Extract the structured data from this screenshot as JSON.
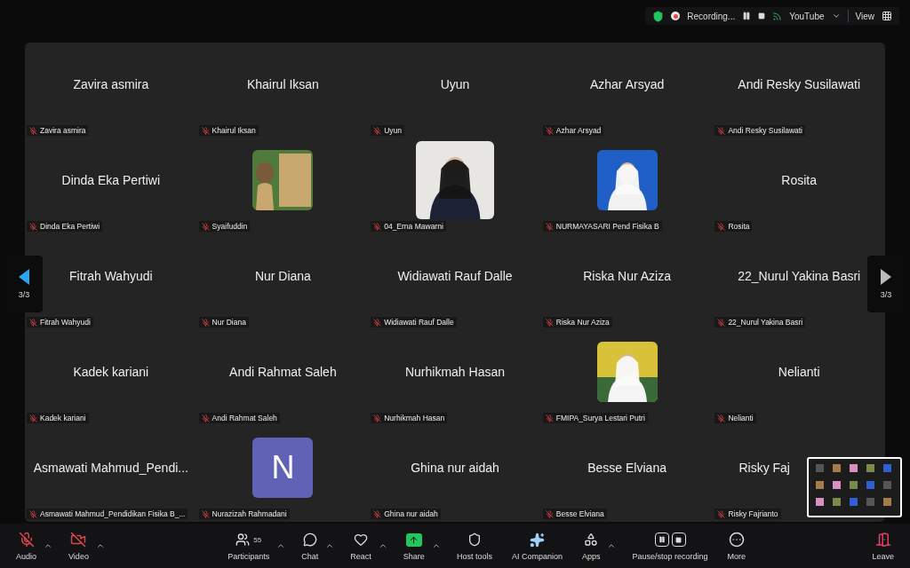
{
  "top_bar": {
    "recording": {
      "label": "Recording..."
    },
    "stream": {
      "label": "YouTube"
    },
    "view": {
      "label": "View"
    }
  },
  "gallery": {
    "page_left": "3/3",
    "page_right": "3/3",
    "tiles": [
      {
        "kind": "name",
        "display": "Zavira asmira",
        "label": "Zavira asmira"
      },
      {
        "kind": "name",
        "display": "Khairul Iksan",
        "label": "Khairul Iksan"
      },
      {
        "kind": "name",
        "display": "Uyun",
        "label": "Uyun"
      },
      {
        "kind": "name",
        "display": "Azhar Arsyad",
        "label": "Azhar Arsyad"
      },
      {
        "kind": "name",
        "display": "Andi Resky Susilawati",
        "label": "Andi Resky Susilawati"
      },
      {
        "kind": "name",
        "display": "Dinda Eka Pertiwi",
        "label": "Dinda Eka Pertiwi"
      },
      {
        "kind": "picture",
        "label": "Syaifuddin"
      },
      {
        "kind": "picture",
        "label": "04_Erna Mawarni"
      },
      {
        "kind": "picture",
        "label": "NURMAYASARI Pend Fisika B"
      },
      {
        "kind": "name",
        "display": "Rosita",
        "label": "Rosita"
      },
      {
        "kind": "name",
        "display": "Fitrah Wahyudi",
        "label": "Fitrah Wahyudi"
      },
      {
        "kind": "name",
        "display": "Nur Diana",
        "label": "Nur Diana"
      },
      {
        "kind": "name",
        "display": "Widiawati Rauf Dalle",
        "label": "Widiawati Rauf Dalle"
      },
      {
        "kind": "name",
        "display": "Riska Nur Aziza",
        "label": "Riska Nur Aziza"
      },
      {
        "kind": "name",
        "display": "22_Nurul Yakina Basri",
        "label": "22_Nurul Yakina Basri"
      },
      {
        "kind": "name",
        "display": "Kadek kariani",
        "label": "Kadek kariani"
      },
      {
        "kind": "name",
        "display": "Andi Rahmat Saleh",
        "label": "Andi Rahmat Saleh"
      },
      {
        "kind": "name",
        "display": "Nurhikmah Hasan",
        "label": "Nurhikmah Hasan"
      },
      {
        "kind": "picture",
        "label": "FMIPA_Surya Lestari Putri"
      },
      {
        "kind": "name",
        "display": "Nelianti",
        "label": "Nelianti"
      },
      {
        "kind": "name",
        "display": "Asmawati Mahmud_Pendi...",
        "label": "Asmawati Mahmud_Pendidikan Fisika B_..."
      },
      {
        "kind": "avatar",
        "initial": "N",
        "color": "#6063b5",
        "label": "Nurazizah Rahmadani"
      },
      {
        "kind": "name",
        "display": "Ghina nur aidah",
        "label": "Ghina nur aidah"
      },
      {
        "kind": "name",
        "display": "Besse Elviana",
        "label": "Besse Elviana"
      },
      {
        "kind": "name",
        "display": "Risky Faj",
        "label": "Risky Fajrianto",
        "partly_hidden": true
      }
    ]
  },
  "toolbar": {
    "left": [
      {
        "kind": "audio",
        "label": "Audio",
        "muted": true,
        "caret": true
      },
      {
        "kind": "video",
        "label": "Video",
        "muted": true,
        "caret": true
      }
    ],
    "center": [
      {
        "kind": "participants",
        "label": "Participants",
        "count": "55",
        "caret": true
      },
      {
        "kind": "chat",
        "label": "Chat",
        "caret": true
      },
      {
        "kind": "react",
        "label": "React",
        "caret": true
      },
      {
        "kind": "share",
        "label": "Share",
        "caret": true
      },
      {
        "kind": "host",
        "label": "Host tools",
        "caret": false
      },
      {
        "kind": "ai",
        "label": "AI Companion",
        "caret": false
      },
      {
        "kind": "apps",
        "label": "Apps",
        "caret": true
      },
      {
        "kind": "record",
        "label": "Pause/stop recording",
        "caret": false
      },
      {
        "kind": "more",
        "label": "More",
        "caret": false
      }
    ],
    "right": [
      {
        "kind": "leave",
        "label": "Leave",
        "caret": false
      }
    ]
  }
}
